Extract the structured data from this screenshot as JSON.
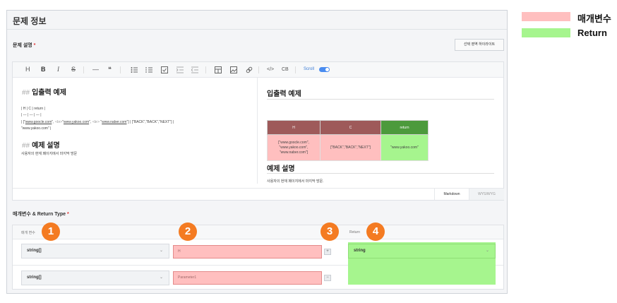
{
  "panel": {
    "title": "문제 정보"
  },
  "description": {
    "label": "문제 설명",
    "required_mark": "*",
    "highlight_button": "선택 영역 하이라이트"
  },
  "toolbar": {
    "heading": "H",
    "bold": "B",
    "italic": "I",
    "strike": "S",
    "hr": "—",
    "quote": "❝",
    "code": "</>",
    "codeblock": "CB",
    "scroll_label": "Scroll"
  },
  "markdown_pane": {
    "heading1_hash": "##",
    "heading1": "입출력 예제",
    "table_header": "| H | C | return |",
    "table_sep": "| --- | --- | --- |",
    "row_prefix": "| [\"",
    "url1": "www.goocle.com",
    "mid1": "\", ",
    "br1": "<br>",
    "q1": "\"",
    "url2": "www.yakoo.com",
    "mid2": "\", ",
    "br2": "<br>",
    "q2": " \"",
    "url3": "www.naber.com",
    "row_suffix": "\"] | [\"BACK\",\"BACK\",\"NEXT\"] |",
    "row_line2": "\"www.yakoo.com\" |",
    "heading2_hash": "##",
    "heading2": "예제 설명",
    "desc": "사용자의 현재 페이지에서 마지막 방문"
  },
  "wysiwyg_pane": {
    "heading1": "입출력 예제",
    "table": {
      "headers": [
        "H",
        "C",
        "return"
      ],
      "h_cell": [
        "[\"www.goocle.com\",",
        "\"www.yakoo.com\",",
        "\"www.naber.com\"]"
      ],
      "c_cell": "[\"BACK\",\"BACK\",\"NEXT\"]",
      "return_cell": "\"www.yakoo.com\""
    },
    "heading2": "예제 설명",
    "desc": "사용자의 현재 페이지에서 마지막 방문."
  },
  "mode_tabs": {
    "markdown": "Markdown",
    "wysiwyg": "WYSIWYG"
  },
  "params_section": {
    "label": "매개변수 & Return Type",
    "required_mark": "*",
    "head_params": "매개 변수",
    "head_return": "Return",
    "rows": [
      {
        "type": "string[]",
        "name": "H",
        "add": "+"
      },
      {
        "type": "string[]",
        "name": "Parameter1",
        "remove": "−"
      }
    ],
    "return_type": "string"
  },
  "badges": [
    "1",
    "2",
    "3",
    "4"
  ],
  "legend": [
    {
      "label": "매개변수",
      "color": "#ffbfbf"
    },
    {
      "label": "Return",
      "color": "#a6f58e"
    }
  ],
  "colors": {
    "param_highlight": "#ffbfbf",
    "return_highlight": "#a6f58e",
    "badge": "#f47b22",
    "table_header_red": "#9e5a5a",
    "table_header_green": "#4c9a3c",
    "toggle": "#4a8cf0"
  },
  "icons": [
    "bullet-list-icon",
    "ordered-list-icon",
    "task-list-icon",
    "indent-icon",
    "outdent-icon",
    "table-icon",
    "image-icon",
    "link-icon",
    "chevron-down-icon"
  ]
}
